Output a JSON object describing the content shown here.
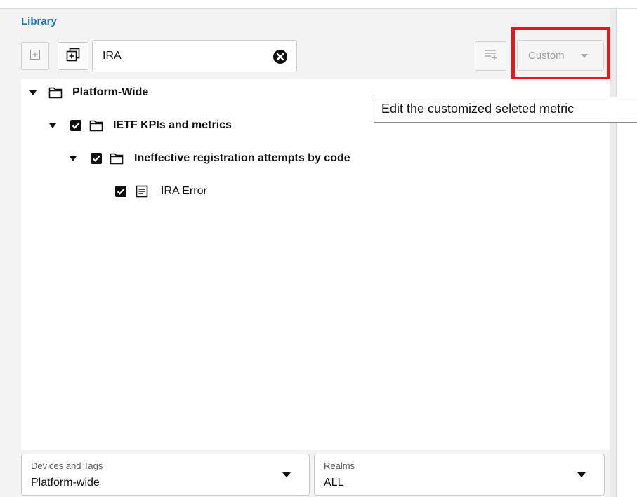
{
  "library": {
    "title": "Library",
    "search": {
      "value": "IRA",
      "placeholder": ""
    },
    "custom_dropdown": {
      "label": "Custom"
    },
    "tooltip": "Edit the customized seleted metric",
    "tree": [
      {
        "label": "Platform-Wide",
        "level": 0,
        "expanded": true,
        "checkbox": false,
        "type": "folder"
      },
      {
        "label": "IETF KPIs and metrics",
        "level": 1,
        "expanded": true,
        "checkbox": true,
        "checked": true,
        "type": "folder"
      },
      {
        "label": "Ineffective registration attempts by code",
        "level": 2,
        "expanded": true,
        "checkbox": true,
        "checked": true,
        "type": "folder"
      },
      {
        "label": "IRA Error",
        "level": 3,
        "checkbox": true,
        "checked": true,
        "type": "metric"
      }
    ]
  },
  "filters": {
    "devices": {
      "label": "Devices and Tags",
      "value": "Platform-wide"
    },
    "realms": {
      "label": "Realms",
      "value": "ALL"
    }
  },
  "colors": {
    "accent": "#1f6fb2",
    "highlight": "#e8141e"
  },
  "icons": {
    "add": "plus-square-icon",
    "expand_all": "expand-all-icon",
    "clear": "clear-circle-icon",
    "list_add": "list-add-icon",
    "folder": "folder-icon",
    "metric": "document-lines-icon"
  }
}
